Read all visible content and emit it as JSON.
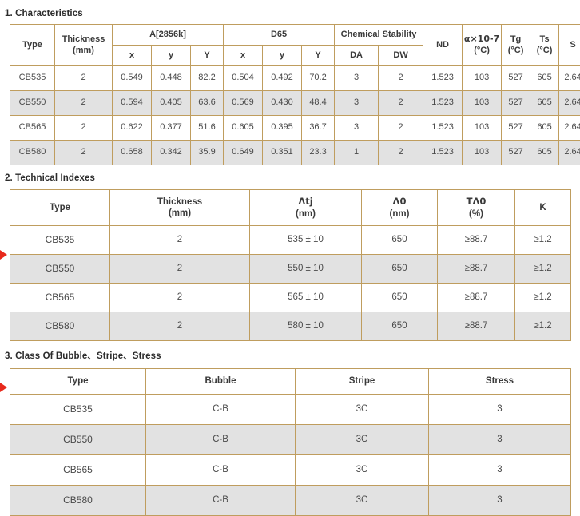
{
  "sections": [
    {
      "id": "characteristics",
      "title": "1. Characteristics"
    },
    {
      "id": "technical-indexes",
      "title": "2. Technical Indexes"
    },
    {
      "id": "class-of-bubble-stripe-stress",
      "title": "3. Class Of Bubble、Stripe、Stress"
    }
  ],
  "table1": {
    "group_headers": {
      "type": "Type",
      "thickness": "Thickness\n(mm)",
      "thickness_l1": "Thickness",
      "thickness_l2": "(mm)",
      "a2856k": "A[2856k]",
      "d65": "D65",
      "chemical_stability": "Chemical Stability",
      "nd": "ND",
      "alpha_l1": "α×10-7",
      "alpha_l2": "(°C)",
      "tg_l1": "Tg",
      "tg_l2": "(°C)",
      "ts_l1": "Ts",
      "ts_l2": "(°C)",
      "s": "S"
    },
    "sub_headers": {
      "a_x": "x",
      "a_y": "y",
      "a_Y": "Y",
      "d_x": "x",
      "d_y": "y",
      "d_Y": "Y",
      "da": "DA",
      "dw": "DW"
    },
    "rows": [
      {
        "type": "CB535",
        "thickness": "2",
        "a_x": "0.549",
        "a_y": "0.448",
        "a_Y": "82.2",
        "d_x": "0.504",
        "d_y": "0.492",
        "d_Y": "70.2",
        "da": "3",
        "dw": "2",
        "nd": "1.523",
        "alpha": "103",
        "tg": "527",
        "ts": "605",
        "s": "2.64"
      },
      {
        "type": "CB550",
        "thickness": "2",
        "a_x": "0.594",
        "a_y": "0.405",
        "a_Y": "63.6",
        "d_x": "0.569",
        "d_y": "0.430",
        "d_Y": "48.4",
        "da": "3",
        "dw": "2",
        "nd": "1.523",
        "alpha": "103",
        "tg": "527",
        "ts": "605",
        "s": "2.64"
      },
      {
        "type": "CB565",
        "thickness": "2",
        "a_x": "0.622",
        "a_y": "0.377",
        "a_Y": "51.6",
        "d_x": "0.605",
        "d_y": "0.395",
        "d_Y": "36.7",
        "da": "3",
        "dw": "2",
        "nd": "1.523",
        "alpha": "103",
        "tg": "527",
        "ts": "605",
        "s": "2.64"
      },
      {
        "type": "CB580",
        "thickness": "2",
        "a_x": "0.658",
        "a_y": "0.342",
        "a_Y": "35.9",
        "d_x": "0.649",
        "d_y": "0.351",
        "d_Y": "23.3",
        "da": "1",
        "dw": "2",
        "nd": "1.523",
        "alpha": "103",
        "tg": "527",
        "ts": "605",
        "s": "2.64"
      }
    ]
  },
  "table2": {
    "headers": {
      "type": "Type",
      "thickness_l1": "Thickness",
      "thickness_l2": "(mm)",
      "lambda_tj_l1": "Λtj",
      "lambda_tj_l2": "(nm)",
      "lambda_0_l1": "Λ0",
      "lambda_0_l2": "(nm)",
      "t_lambda_0_l1": "TΛ0",
      "t_lambda_0_l2": "(%)",
      "k": "K"
    },
    "rows": [
      {
        "type": "CB535",
        "thickness": "2",
        "lambda_tj": "535 ± 10",
        "lambda_0": "650",
        "t_lambda_0": "≥88.7",
        "k": "≥1.2"
      },
      {
        "type": "CB550",
        "thickness": "2",
        "lambda_tj": "550 ± 10",
        "lambda_0": "650",
        "t_lambda_0": "≥88.7",
        "k": "≥1.2"
      },
      {
        "type": "CB565",
        "thickness": "2",
        "lambda_tj": "565 ± 10",
        "lambda_0": "650",
        "t_lambda_0": "≥88.7",
        "k": "≥1.2"
      },
      {
        "type": "CB580",
        "thickness": "2",
        "lambda_tj": "580 ± 10",
        "lambda_0": "650",
        "t_lambda_0": "≥88.7",
        "k": "≥1.2"
      }
    ]
  },
  "table3": {
    "headers": {
      "type": "Type",
      "bubble": "Bubble",
      "stripe": "Stripe",
      "stress": "Stress"
    },
    "rows": [
      {
        "type": "CB535",
        "bubble": "C-B",
        "stripe": "3C",
        "stress": "3"
      },
      {
        "type": "CB550",
        "bubble": "C-B",
        "stripe": "3C",
        "stress": "3"
      },
      {
        "type": "CB565",
        "bubble": "C-B",
        "stripe": "3C",
        "stress": "3"
      },
      {
        "type": "CB580",
        "bubble": "C-B",
        "stripe": "3C",
        "stress": "3"
      }
    ]
  },
  "markers": {
    "table2_arrow": "red-arrow-marker",
    "table3_arrow": "red-arrow-marker"
  },
  "colors": {
    "border": "#bf9d5e",
    "alt_row": "#e2e2e2",
    "link": "#2e5f9e",
    "marker": "#e8291c",
    "text": "#4a4a4a"
  }
}
